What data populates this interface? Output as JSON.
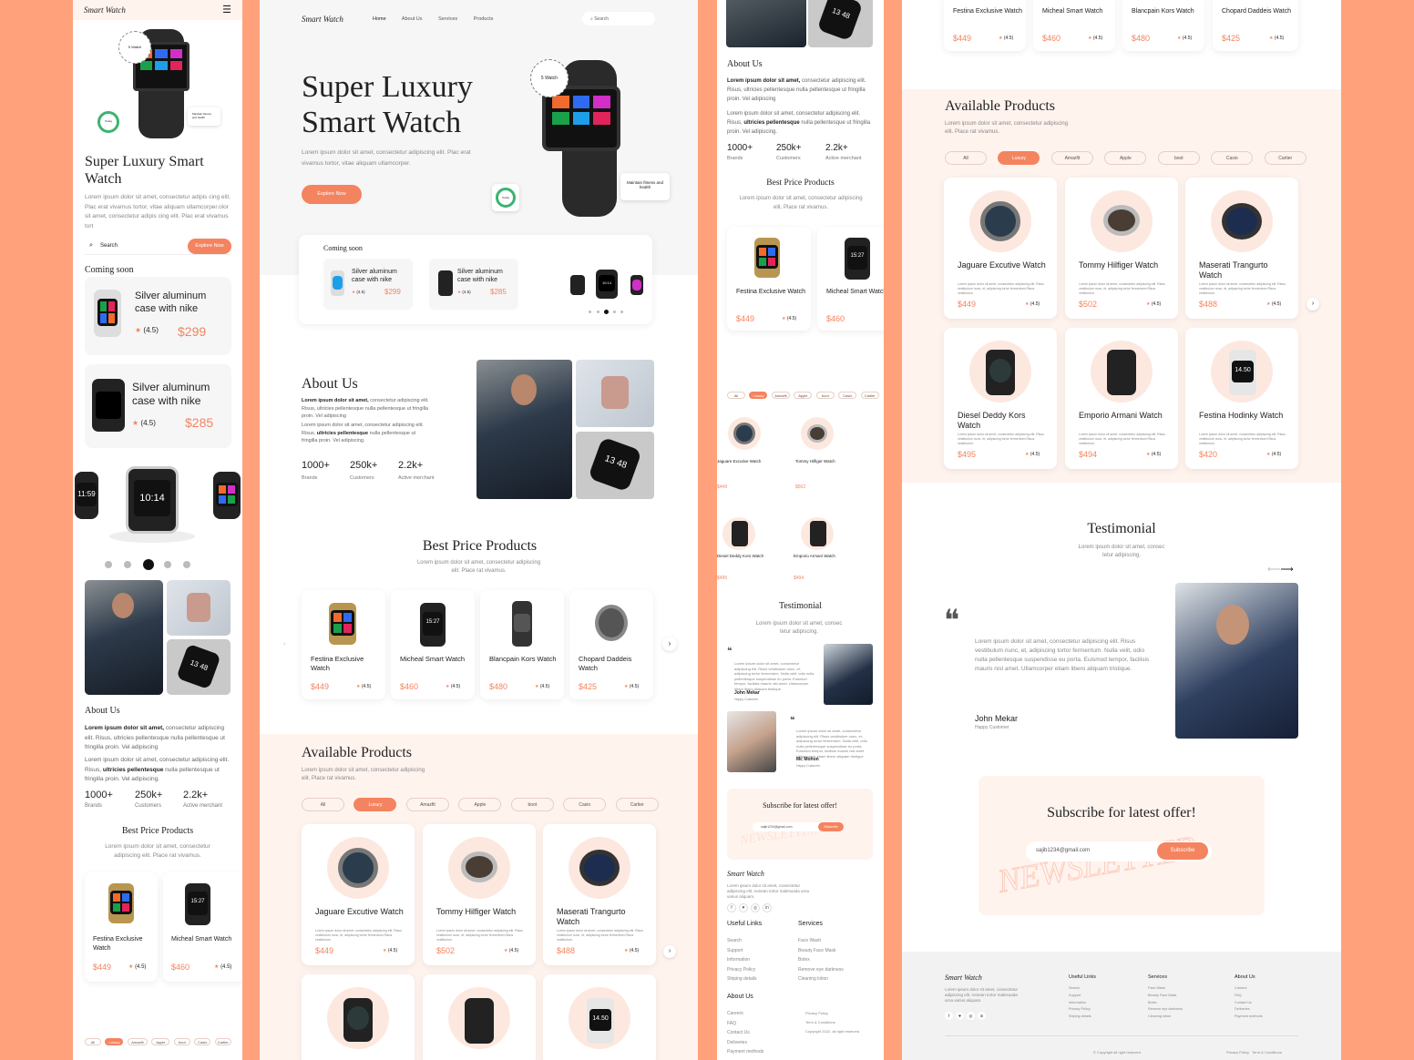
{
  "brand": "Smart Watch",
  "nav": [
    "Home",
    "About Us",
    "Services",
    "Products"
  ],
  "search": {
    "placeholder": "Search"
  },
  "hero": {
    "title_l1": "Super Luxury",
    "title_l2": "Smart Watch",
    "m_title_l1": "Super Luxury Smart",
    "m_title_l2": "Watch",
    "desc": "Lorem ipsum dolor sit amet, consectetur adipiscing elit. Plac erat vivamus tortor, vitae aliquam ullamcorper.",
    "m_desc": "Lorem ipsum dolor sit amet, consectetur adipis cing elit. Plac erat vivamus tortor, vitae aliquam ullamcorper.olor sit amet, consectetur adipis cing elit. Plac erat vivamus tort",
    "cta": "Explore Now",
    "badge_ring": "Here Get 5 Watch 25% Discount",
    "badge_inner": "5 Watch",
    "tag": "Maintain fitness and health",
    "today": "Today",
    "steps": "Steps"
  },
  "watch_time": "15:27",
  "watch_time2": "10:14",
  "watch_time3": "11:59",
  "watch_time4": "14.50",
  "watch_time5": "13 48",
  "coming": {
    "title": "Coming soon",
    "items": [
      {
        "name": "Silver aluminum case with nike",
        "rating": "(4.5)",
        "price": "$299"
      },
      {
        "name": "Silver aluminum case with nike",
        "rating": "(4.5)",
        "price": "$285"
      }
    ]
  },
  "about": {
    "title": "About Us",
    "p1_b": "Lorem ipsum dolor sit amet,",
    "p1": " consectetur adipiscing elit. Risus, ultricies pellentesque nulla pellentesque ut fringilla proin. Vel adipiscing",
    "p2a": "Lorem ipsum dolor sit amet, consectetur adipiscing elit. Risus,",
    "p2_b": " ultricies pellentesque",
    "p2": " nulla pellentesque ut fringilla proin. Vel adipiscing.",
    "stats": [
      {
        "value": "1000+",
        "label": "Brands"
      },
      {
        "value": "250k+",
        "label": "Customers"
      },
      {
        "value": "2.2k+",
        "label": "Active merchant"
      }
    ]
  },
  "best": {
    "title": "Best Price Products",
    "desc": "Lorem ipsum dolor sit amet, consectetur adipiscing elit. Place rat vivamus.",
    "items": [
      {
        "name": "Festina Exclusive Watch",
        "price": "$449",
        "rating": "(4.5)"
      },
      {
        "name": "Micheal Smart Watch",
        "price": "$460",
        "rating": "(4.5)"
      },
      {
        "name": "Blancpain Kors Watch",
        "price": "$480",
        "rating": "(4.5)"
      },
      {
        "name": "Chopard Daddeis Watch",
        "price": "$425",
        "rating": "(4.5)"
      }
    ]
  },
  "avail": {
    "title": "Available Products",
    "desc": "Lorem ipsum dolor sit amet, consectetur adipiscing elit. Place rat vivamus.",
    "filters": [
      "All",
      "Luxury",
      "Amazfit",
      "Apple",
      "boot",
      "Casio",
      "Cartier"
    ],
    "desc_small": "Lorem ipsum dolor sit amet, consectetur adipiscing elit. Risus vestibulum nunc, et, adipiscing tortor fermentum Risus vestibulum.",
    "items": [
      {
        "name": "Jaguare Excutive Watch",
        "price": "$449",
        "rating": "(4.5)"
      },
      {
        "name": "Tommy Hilfiger Watch",
        "price": "$502",
        "rating": "(4.5)"
      },
      {
        "name": "Maserati Trangurto Watch",
        "price": "$488",
        "rating": "(4.5)"
      },
      {
        "name": "Diesel Deddy Kors Watch",
        "price": "$495",
        "rating": "(4.5)"
      },
      {
        "name": "Emporio Armani Watch",
        "price": "$494",
        "rating": "(4.5)"
      },
      {
        "name": "Festina Hodinky Watch",
        "price": "$420",
        "rating": "(4.5)"
      }
    ]
  },
  "testimonial": {
    "title": "Testimonial",
    "desc": "Lorem ipsum dolor sit amet, consec tetur adipiscing.",
    "quote": "Lorem ipsum dolor sit amet, consectetur adipiscing elit. Risus vestibulum nunc, et, adipiscing tortor fermentum. Nulla velit, odio nulla pellentesque suspendisse eu porta. Euismod tempor, facilisis mauris nisl amet. Ullamcorper etiam libero aliquam tristique.",
    "name": "John Mekar",
    "role": "Happy Customer",
    "name2": "Mc Mohon"
  },
  "subscribe": {
    "title": "Subscribe for latest offer!",
    "email": "sajib1234@gmail.com",
    "button": "Subscribe",
    "bg_word": "NEWSLETTER"
  },
  "footer": {
    "desc": "Lorem ipsum dolor sit amet, consectetur adipiscing elit. Aenean tortor malesuada urna varius aliquam.",
    "useful_title": "Useful Links",
    "useful": [
      "Search",
      "Support",
      "Information",
      "Privacy Policy",
      "Shiping details"
    ],
    "services_title": "Services",
    "services": [
      "Face Wash",
      "Beauty Face Mask",
      "Botex",
      "Remove eye darkness",
      "Cleaning lotion"
    ],
    "about_title": "About Us",
    "about": [
      "Careers",
      "FAQ",
      "Contact Us",
      "Deliveries",
      "Payment methods"
    ],
    "copyright": "© Copyright all right reserved",
    "privacy": "Privacy Policy",
    "terms": "Term & Conditions",
    "copy2": "Copyright 2022. all right reserved"
  },
  "colors": {
    "accent": "#f4845f",
    "bg": "#ffa27c",
    "soft": "#fff3ee"
  }
}
